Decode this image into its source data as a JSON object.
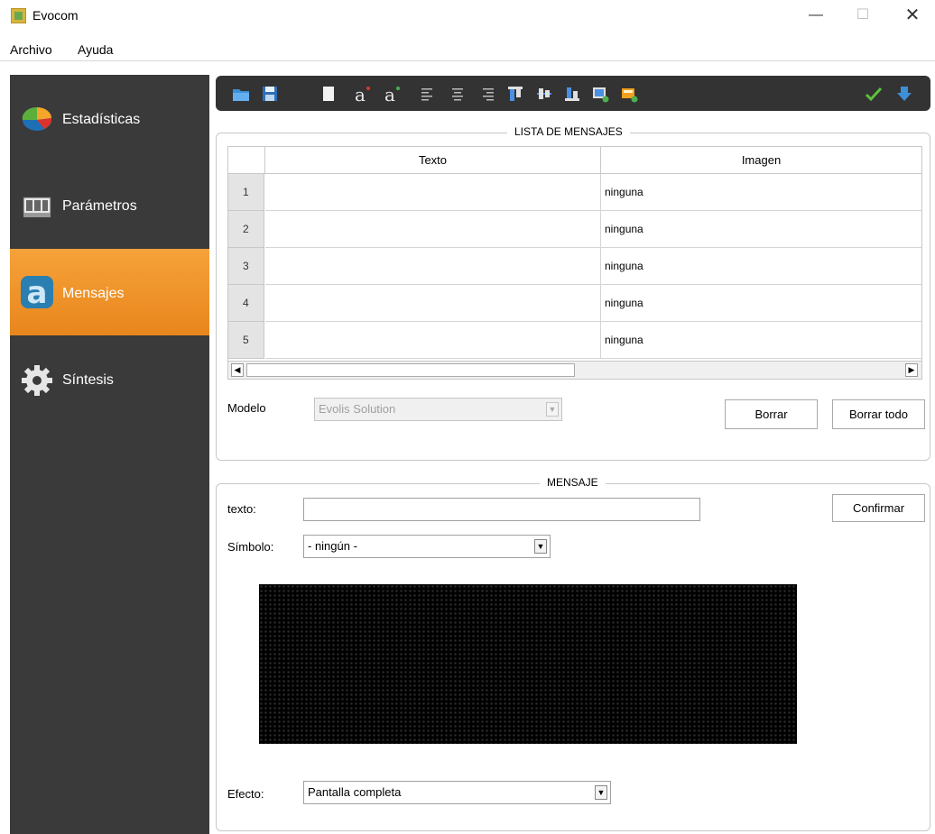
{
  "window": {
    "title": "Evocom",
    "min": "—",
    "max": "☐",
    "close": "✕"
  },
  "menu": {
    "items": [
      "Archivo",
      "Ayuda"
    ]
  },
  "sidebar": {
    "items": [
      {
        "label": "Estadísticas",
        "icon": "pie-chart-icon"
      },
      {
        "label": "Parámetros",
        "icon": "panel-icon"
      },
      {
        "label": "Mensajes",
        "icon": "letter-a-icon",
        "active": true
      },
      {
        "label": "Síntesis",
        "icon": "gear-icon"
      }
    ]
  },
  "toolbar": {
    "icons": [
      "open-folder-icon",
      "save-icon",
      "blank-page-icon",
      "font-a-red-icon",
      "font-a-green-icon",
      "align-left-icon",
      "align-center-icon",
      "align-right-icon",
      "align-top-icon",
      "align-middle-icon",
      "align-bottom-icon",
      "insert-image-icon",
      "image-effect-icon",
      "check-icon",
      "download-icon"
    ]
  },
  "list": {
    "title": "LISTA DE MENSAJES",
    "columns": [
      "Texto",
      "Imagen"
    ],
    "rows": [
      {
        "num": "1",
        "texto": "",
        "imagen": "ninguna"
      },
      {
        "num": "2",
        "texto": "",
        "imagen": "ninguna"
      },
      {
        "num": "3",
        "texto": "",
        "imagen": "ninguna"
      },
      {
        "num": "4",
        "texto": "",
        "imagen": "ninguna"
      },
      {
        "num": "5",
        "texto": "",
        "imagen": "ninguna"
      }
    ],
    "modelo_label": "Modelo",
    "modelo_value": "Evolis Solution",
    "borrar": "Borrar",
    "borrar_todo": "Borrar todo"
  },
  "mensaje": {
    "title": "MENSAJE",
    "texto_label": "texto:",
    "texto_value": "",
    "confirmar": "Confirmar",
    "simbolo_label": "Símbolo:",
    "simbolo_value": "- ningún -",
    "efecto_label": "Efecto:",
    "efecto_value": "Pantalla completa"
  },
  "colors": {
    "sidebar": "#3a3a3a",
    "active": "#f39a2d",
    "toolbar": "#333333",
    "display": "#000000"
  }
}
